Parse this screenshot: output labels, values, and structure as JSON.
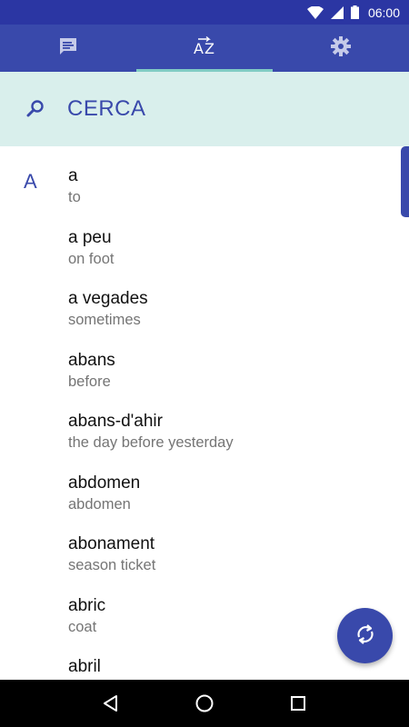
{
  "status_bar": {
    "time": "06:00"
  },
  "tabs": [
    {
      "name": "messages",
      "icon": "chat-bubble-icon",
      "active": false
    },
    {
      "name": "az",
      "label": "AZ",
      "icon": "sort-az-icon",
      "active": true
    },
    {
      "name": "settings",
      "icon": "gear-icon",
      "active": false
    }
  ],
  "search": {
    "placeholder": "CERCA",
    "value": ""
  },
  "list": {
    "section_letter": "A",
    "entries": [
      {
        "word": "a",
        "translation": "to"
      },
      {
        "word": "a peu",
        "translation": "on foot"
      },
      {
        "word": "a vegades",
        "translation": "sometimes"
      },
      {
        "word": "abans",
        "translation": "before"
      },
      {
        "word": "abans-d'ahir",
        "translation": "the day before yesterday"
      },
      {
        "word": "abdomen",
        "translation": "abdomen"
      },
      {
        "word": "abonament",
        "translation": "season ticket"
      },
      {
        "word": "abric",
        "translation": "coat"
      },
      {
        "word": "abril",
        "translation": ""
      }
    ]
  },
  "fab": {
    "icon": "sync-icon"
  },
  "colors": {
    "primary": "#3949ab",
    "status_bar": "#2b36a3",
    "accent": "#80cbc4",
    "search_bg": "#d9efec"
  }
}
